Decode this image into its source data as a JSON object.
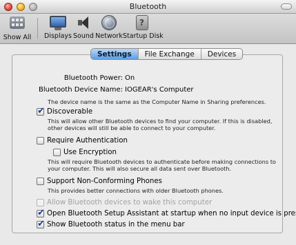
{
  "window": {
    "title": "Bluetooth"
  },
  "toolbar": {
    "items": [
      {
        "label": "Show All",
        "icon": "grid-icon"
      },
      {
        "label": "Displays",
        "icon": "display-icon"
      },
      {
        "label": "Sound",
        "icon": "speaker-icon"
      },
      {
        "label": "Network",
        "icon": "globe-icon"
      },
      {
        "label": "Startup Disk",
        "icon": "disk-icon"
      }
    ]
  },
  "tabs": [
    {
      "label": "Settings",
      "active": true
    },
    {
      "label": "File Exchange",
      "active": false
    },
    {
      "label": "Devices",
      "active": false
    }
  ],
  "settings": {
    "power_label": "Bluetooth Power:",
    "power_value": "On",
    "name_label": "Bluetooth Device Name:",
    "name_value": "IOGEAR's Computer",
    "name_note": "The device name is the same as the Computer Name in Sharing preferences.",
    "discoverable": {
      "label": "Discoverable",
      "checked": true,
      "desc1": "This will allow other Bluetooth devices to find your computer.  If this is disabled,",
      "desc2": "other devices will still be able to connect to your computer."
    },
    "require_auth": {
      "label": "Require Authentication",
      "checked": false
    },
    "use_encryption": {
      "label": "Use Encryption",
      "checked": false,
      "desc1": "This will require Bluetooth devices to authenticate before making connections to",
      "desc2": "your computer. This will also secure all data sent over Bluetooth."
    },
    "non_conforming": {
      "label": "Support Non-Conforming Phones",
      "checked": false,
      "desc1": "This provides better connections with older Bluetooth phones."
    },
    "allow_wake": {
      "label": "Allow Bluetooth devices to wake this computer",
      "checked": false,
      "disabled": true
    },
    "setup_assistant": {
      "label": "Open Bluetooth Setup Assistant at startup when no input device is present",
      "checked": true
    },
    "menu_status": {
      "label": "Show Bluetooth status in the menu bar",
      "checked": true
    }
  }
}
